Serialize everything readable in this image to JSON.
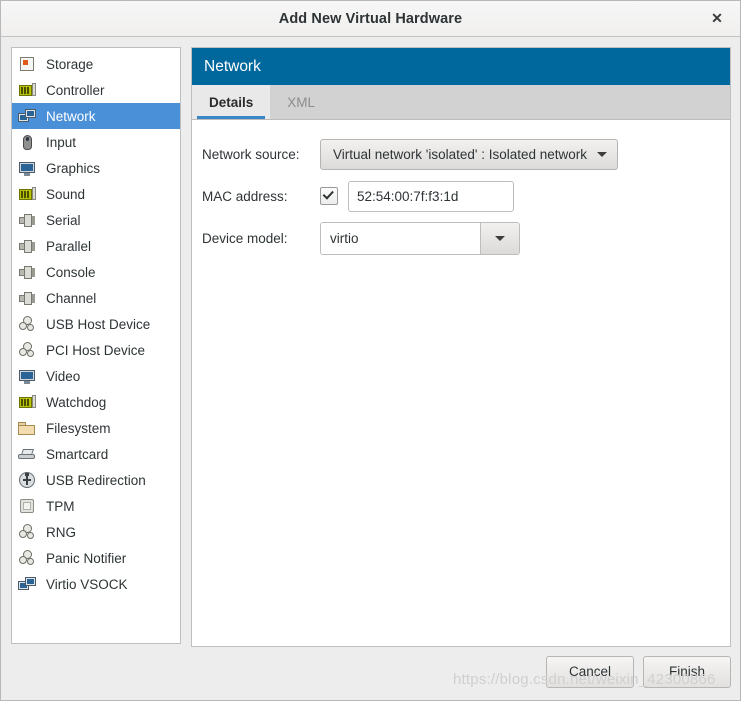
{
  "window": {
    "title": "Add New Virtual Hardware",
    "close_label": "✕",
    "close_icon": "close-icon"
  },
  "sidebar": {
    "items": [
      {
        "label": "Storage",
        "icon": "disk-icon",
        "selected": false
      },
      {
        "label": "Controller",
        "icon": "controller-card-icon",
        "selected": false
      },
      {
        "label": "Network",
        "icon": "network-icon",
        "selected": true
      },
      {
        "label": "Input",
        "icon": "mouse-icon",
        "selected": false
      },
      {
        "label": "Graphics",
        "icon": "monitor-icon",
        "selected": false
      },
      {
        "label": "Sound",
        "icon": "sound-card-icon",
        "selected": false
      },
      {
        "label": "Serial",
        "icon": "serial-plug-icon",
        "selected": false
      },
      {
        "label": "Parallel",
        "icon": "parallel-plug-icon",
        "selected": false
      },
      {
        "label": "Console",
        "icon": "console-plug-icon",
        "selected": false
      },
      {
        "label": "Channel",
        "icon": "channel-plug-icon",
        "selected": false
      },
      {
        "label": "USB Host Device",
        "icon": "gears-icon",
        "selected": false
      },
      {
        "label": "PCI Host Device",
        "icon": "gears-icon",
        "selected": false
      },
      {
        "label": "Video",
        "icon": "video-monitor-icon",
        "selected": false
      },
      {
        "label": "Watchdog",
        "icon": "watchdog-card-icon",
        "selected": false
      },
      {
        "label": "Filesystem",
        "icon": "folder-icon",
        "selected": false
      },
      {
        "label": "Smartcard",
        "icon": "smartcard-icon",
        "selected": false
      },
      {
        "label": "USB Redirection",
        "icon": "usb-icon",
        "selected": false
      },
      {
        "label": "TPM",
        "icon": "chip-icon",
        "selected": false
      },
      {
        "label": "RNG",
        "icon": "gears-icon",
        "selected": false
      },
      {
        "label": "Panic Notifier",
        "icon": "gears-icon",
        "selected": false
      },
      {
        "label": "Virtio VSOCK",
        "icon": "network-icon",
        "selected": false
      }
    ]
  },
  "panel": {
    "header_title": "Network",
    "header_color": "#00689d",
    "accent_color": "#3a86c8",
    "selection_color": "#4a90d9",
    "tabs": [
      {
        "label": "Details",
        "active": true
      },
      {
        "label": "XML",
        "active": false
      }
    ],
    "form": {
      "network_source": {
        "label": "Network source:",
        "value": "Virtual network 'isolated' : Isolated network",
        "arrow_icon": "chevron-down-icon"
      },
      "mac_address": {
        "label": "MAC address:",
        "checked": true,
        "check_icon": "checkmark-icon",
        "value": "52:54:00:7f:f3:1d"
      },
      "device_model": {
        "label": "Device model:",
        "value": "virtio",
        "arrow_icon": "chevron-down-icon"
      }
    }
  },
  "footer": {
    "cancel_label": "Cancel",
    "finish_label": "Finish"
  },
  "watermark": {
    "text": "https://blog.csdn.net/weixin_42300866"
  }
}
